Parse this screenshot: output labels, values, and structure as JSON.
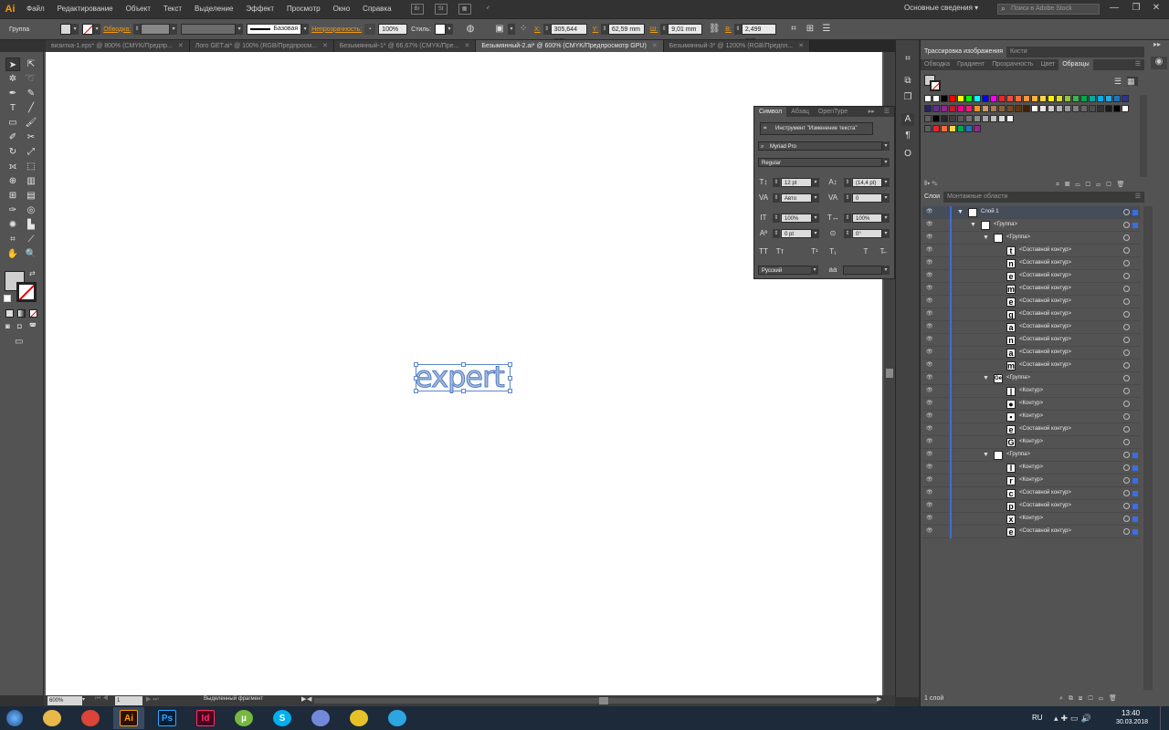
{
  "app": {
    "logo": "Ai"
  },
  "menu": [
    "Файл",
    "Редактирование",
    "Объект",
    "Текст",
    "Выделение",
    "Эффект",
    "Просмотр",
    "Окно",
    "Справка"
  ],
  "menu_icons": {
    "br": "Br",
    "st": "St"
  },
  "workspace": "Основные сведения",
  "stock_search": {
    "placeholder": "Поиск в Adobe Stock"
  },
  "control": {
    "selection_type": "Группа",
    "stroke_label": "Обводка:",
    "stroke_profile": "Базовая",
    "opacity_label": "Непрозрачность:",
    "opacity": "100%",
    "style_label": "Стиль:",
    "x_label": "X:",
    "x": "305,644 mm",
    "y_label": "Y:",
    "y": "62,59 mm",
    "w_label": "Ш:",
    "w": "9,01 mm",
    "h_label": "В:",
    "h": "2,499 mm"
  },
  "tabs": [
    {
      "label": "визитка-1.eps* @ 800% (CMYK/Предпр...",
      "active": false
    },
    {
      "label": "Лого GET.ai* @ 100% (RGB/Предпросм...",
      "active": false
    },
    {
      "label": "Безымянный-1* @ 66,67% (CMYK/Пре...",
      "active": false
    },
    {
      "label": "Безымянный-2.ai* @ 600% (CMYK/Предпросмотр GPU)",
      "active": true
    },
    {
      "label": "Безымянный-3* @ 1200% (RGB/Предпл...",
      "active": false
    }
  ],
  "canvas": {
    "text": "expert"
  },
  "status": {
    "zoom": "600%",
    "artboard": "1",
    "tool": "Выделенный фрагмент"
  },
  "character": {
    "tabs": [
      "Символ",
      "Абзац",
      "OpenType"
    ],
    "touch_tool": "Инструмент \"Изменение текста\"",
    "font_family": "Myriad Pro",
    "font_style": "Regular",
    "size": "12 pt",
    "leading": "(14,4 pt)",
    "kerning": "Авто",
    "tracking": "0",
    "vscale": "100%",
    "hscale": "100%",
    "baseline": "0 pt",
    "rotation": "0°",
    "language": "Русский"
  },
  "right_tabs_top": [
    "Трассировка изображения",
    "Кисти"
  ],
  "right_tabs_mid": [
    "Обводка",
    "Градиент",
    "Прозрачность",
    "Цвет",
    "Образцы"
  ],
  "layers_tabs": [
    "Слои",
    "Монтажные области"
  ],
  "layers": [
    {
      "label": "Слой 1",
      "indent": 0,
      "thumb": "",
      "tri": true
    },
    {
      "label": "<Группа>",
      "indent": 1,
      "thumb": "",
      "tri": true
    },
    {
      "label": "<Группа>",
      "indent": 2,
      "thumb": "",
      "tri": true
    },
    {
      "label": "<Составной контур>",
      "indent": 3,
      "thumb": "t",
      "tri": false
    },
    {
      "label": "<Составной контур>",
      "indent": 3,
      "thumb": "n",
      "tri": false
    },
    {
      "label": "<Составной контур>",
      "indent": 3,
      "thumb": "e",
      "tri": false
    },
    {
      "label": "<Составной контур>",
      "indent": 3,
      "thumb": "m",
      "tri": false
    },
    {
      "label": "<Составной контур>",
      "indent": 3,
      "thumb": "e",
      "tri": false
    },
    {
      "label": "<Составной контур>",
      "indent": 3,
      "thumb": "g",
      "tri": false
    },
    {
      "label": "<Составной контур>",
      "indent": 3,
      "thumb": "a",
      "tri": false
    },
    {
      "label": "<Составной контур>",
      "indent": 3,
      "thumb": "n",
      "tri": false
    },
    {
      "label": "<Составной контур>",
      "indent": 3,
      "thumb": "a",
      "tri": false
    },
    {
      "label": "<Составной контур>",
      "indent": 3,
      "thumb": "m",
      "tri": false
    },
    {
      "label": "<Группа>",
      "indent": 2,
      "thumb": "Ge",
      "tri": true
    },
    {
      "label": "<Контур>",
      "indent": 3,
      "thumb": "|",
      "tri": false
    },
    {
      "label": "<Контур>",
      "indent": 3,
      "thumb": "●",
      "tri": false
    },
    {
      "label": "<Контур>",
      "indent": 3,
      "thumb": "▪",
      "tri": false
    },
    {
      "label": "<Составной контур>",
      "indent": 3,
      "thumb": "e",
      "tri": false
    },
    {
      "label": "<Контур>",
      "indent": 3,
      "thumb": "G",
      "tri": false
    },
    {
      "label": "<Группа>",
      "indent": 2,
      "thumb": "",
      "tri": true
    },
    {
      "label": "<Контур>",
      "indent": 3,
      "thumb": "l",
      "tri": false
    },
    {
      "label": "<Контур>",
      "indent": 3,
      "thumb": "r",
      "tri": false
    },
    {
      "label": "<Составной контур>",
      "indent": 3,
      "thumb": "c",
      "tri": false
    },
    {
      "label": "<Составной контур>",
      "indent": 3,
      "thumb": "p",
      "tri": false
    },
    {
      "label": "<Контур>",
      "indent": 3,
      "thumb": "x",
      "tri": false
    },
    {
      "label": "<Составной контур>",
      "indent": 3,
      "thumb": "e",
      "tri": false
    }
  ],
  "layers_count": "1 слой",
  "taskbar": {
    "apps": [
      {
        "name": "explorer",
        "label": "",
        "color": "#e8b84a"
      },
      {
        "name": "chrome",
        "label": "",
        "color": "#db4437"
      },
      {
        "name": "illustrator",
        "label": "Ai",
        "color": "#ff9a00"
      },
      {
        "name": "photoshop",
        "label": "Ps",
        "color": "#31a8ff"
      },
      {
        "name": "indesign",
        "label": "Id",
        "color": "#ff3366"
      },
      {
        "name": "utorrent",
        "label": "µ",
        "color": "#76b83f"
      },
      {
        "name": "skype",
        "label": "S",
        "color": "#00aff0"
      },
      {
        "name": "discord",
        "label": "",
        "color": "#7289da"
      },
      {
        "name": "store",
        "label": "",
        "color": "#e6c229"
      },
      {
        "name": "telegram",
        "label": "",
        "color": "#2ca5e0"
      }
    ],
    "lang": "RU",
    "time": "13:40",
    "date": "30.03.2018"
  }
}
